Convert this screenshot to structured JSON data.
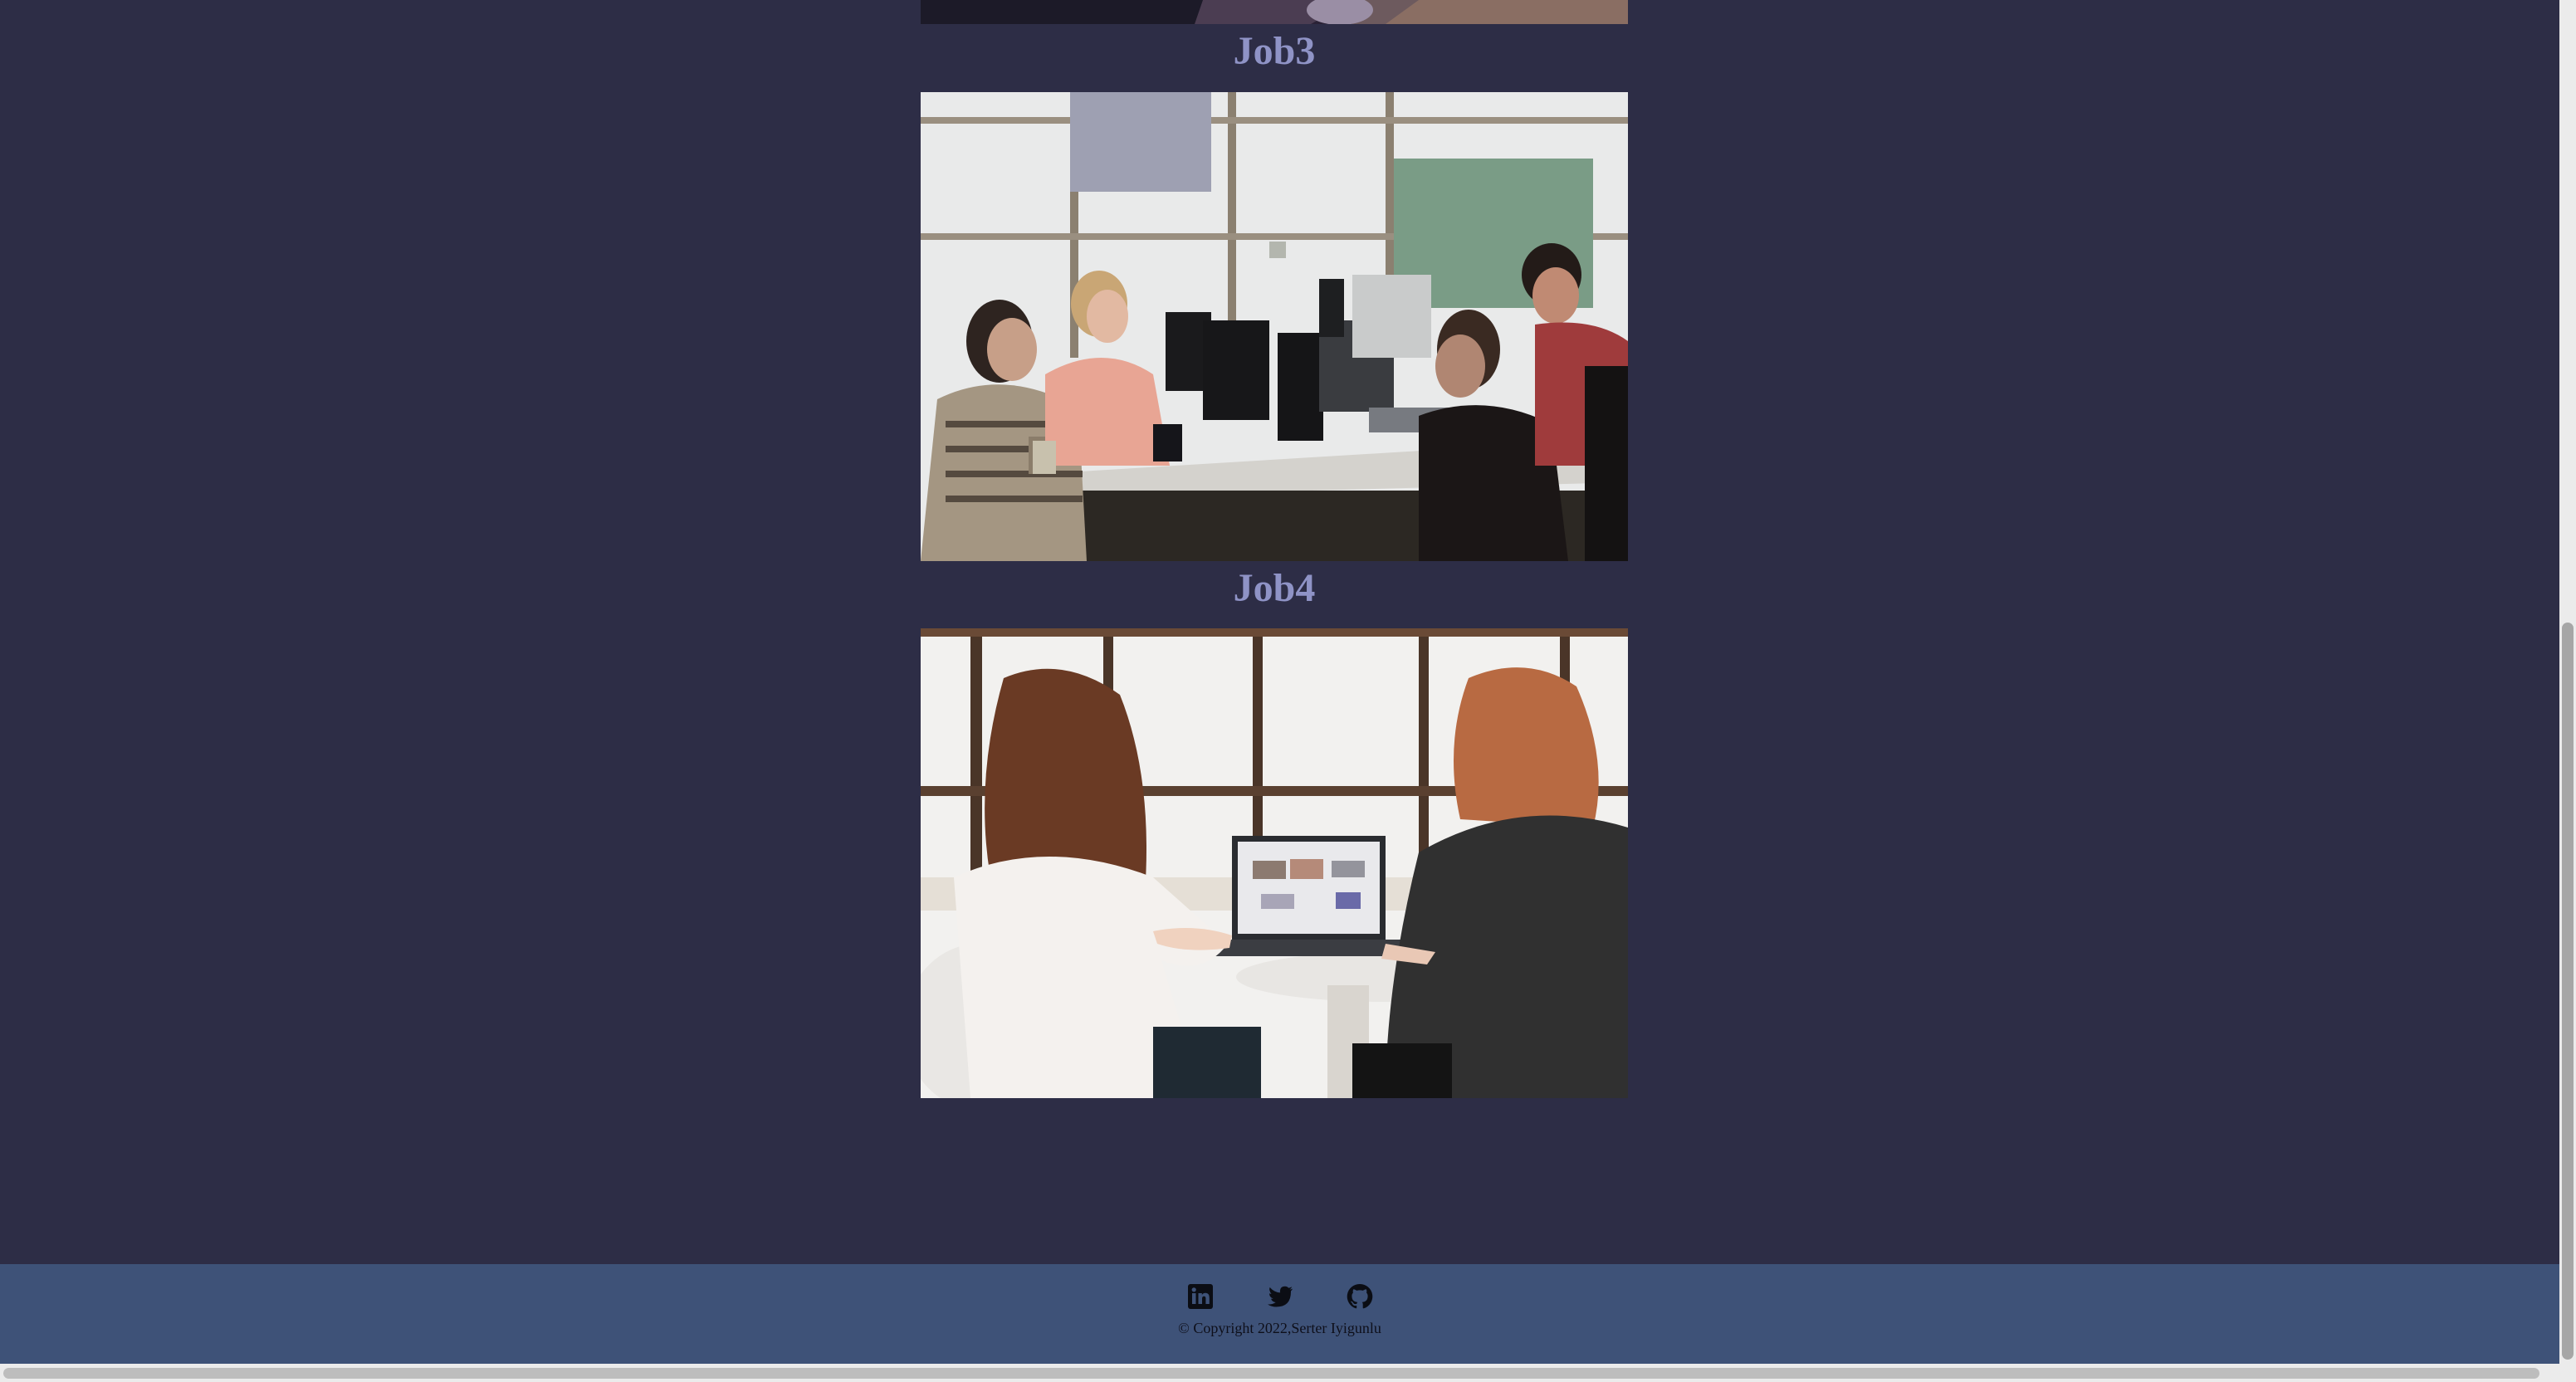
{
  "jobs": [
    {
      "title": "Job3"
    },
    {
      "title": "Job4"
    }
  ],
  "images": {
    "top": "partially visible job photo (dark, cropped at top)",
    "job3": "people working at desks with computer monitors in a bright office",
    "job4": "two women seen from behind looking at a laptop on a white table"
  },
  "footer": {
    "socials": [
      {
        "name": "linkedin",
        "icon": "linkedin-icon"
      },
      {
        "name": "twitter",
        "icon": "twitter-icon"
      },
      {
        "name": "github",
        "icon": "github-icon"
      }
    ],
    "copyright": "© Copyright 2022,Serter Iyigunlu"
  },
  "colors": {
    "page_bg": "#2d2d46",
    "heading": "#8f93c6",
    "footer_bg": "#3e5278"
  }
}
